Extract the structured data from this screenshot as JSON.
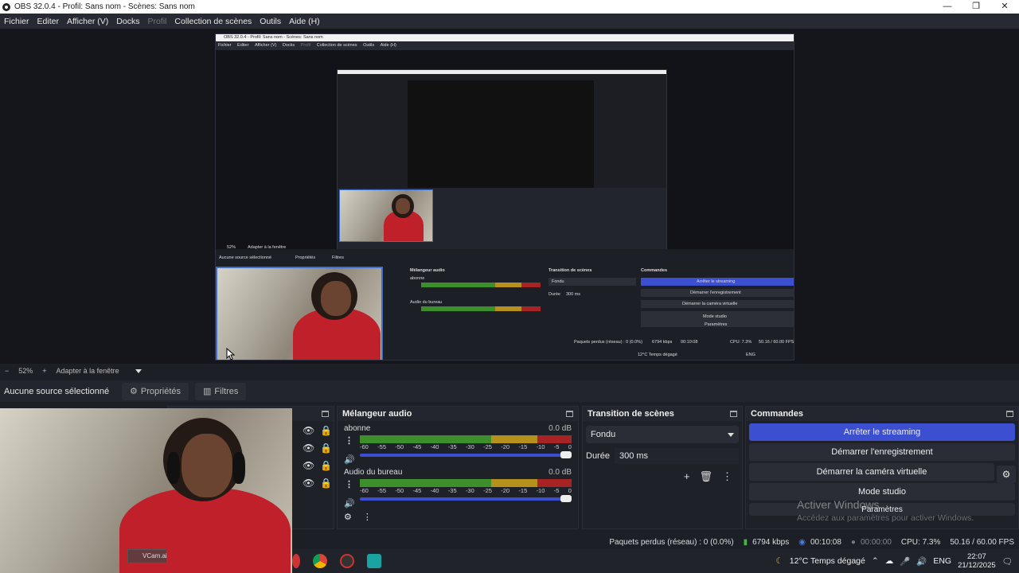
{
  "window": {
    "title": "OBS 32.0.4 - Profil: Sans nom - Scènes: Sans nom",
    "minimize": "—",
    "maximize": "❐",
    "close": "✕"
  },
  "menu": {
    "fichier": "Fichier",
    "editer": "Editer",
    "afficher": "Afficher (V)",
    "docks": "Docks",
    "profil": "Profil",
    "collection": "Collection de scènes",
    "outils": "Outils",
    "aide": "Aide (H)"
  },
  "zoom": {
    "minus": "−",
    "value": "52%",
    "plus": "+",
    "fit": "Adapter à la fenêtre"
  },
  "sourcebar": {
    "label": "Aucune source sélectionné",
    "properties": "Propriétés",
    "filters": "Filtres"
  },
  "webcam": {
    "overlay_text": "VCam.ai"
  },
  "mixer": {
    "title": "Mélangeur audio",
    "tracks": [
      {
        "name": "abonne",
        "db": "0.0 dB"
      },
      {
        "name": "Audio du bureau",
        "db": "0.0 dB"
      }
    ],
    "scale": [
      "-60",
      "-55",
      "-50",
      "-45",
      "-40",
      "-35",
      "-30",
      "-25",
      "-20",
      "-15",
      "-10",
      "-5",
      "0"
    ]
  },
  "transition": {
    "title": "Transition de scènes",
    "selected": "Fondu",
    "duration_label": "Durée",
    "duration_value": "300 ms"
  },
  "commands": {
    "title": "Commandes",
    "stop_stream": "Arrêter le streaming",
    "start_record": "Démarrer l'enregistrement",
    "virtual_cam": "Démarrer la caméra virtuelle",
    "studio_mode": "Mode studio",
    "settings": "Paramètres"
  },
  "watermark": {
    "line1": "Activer Windows",
    "line2": "Accédez aux paramètres pour activer Windows."
  },
  "status": {
    "dropped": "Paquets perdus (réseau) : 0 (0.0%)",
    "bitrate": "6794 kbps",
    "stream_time": "00:10:08",
    "rec_time": "00:00:00",
    "cpu": "CPU: 7.3%",
    "fps": "50.16 / 60.00 FPS"
  },
  "taskbar": {
    "weather": "12°C  Temps dégagé",
    "lang": "ENG",
    "time": "22:07",
    "date": "21/12/2025"
  },
  "nested": {
    "title": "OBS 32.0.4 - Profil: Sans nom - Scènes: Sans nom",
    "menu": [
      "Fichier",
      "Editer",
      "Afficher (V)",
      "Docks",
      "Profil",
      "Collection de scènes",
      "Outils",
      "Aide (H)"
    ],
    "zoom": "52%",
    "fit": "Adapter à la fenêtre",
    "no_source": "Aucune source sélectionné",
    "props": "Propriétés",
    "filters": "Filtres",
    "mixer": "Mélangeur audio",
    "track1": "abonne",
    "track2": "Audio du bureau",
    "transition": "Transition de scènes",
    "fondu": "Fondu",
    "duree": "Durée",
    "duree_val": "300 ms",
    "commandes": "Commandes",
    "stop": "Arrêter le streaming",
    "record": "Démarrer l'enregistrement",
    "vcam": "Démarrer la caméra virtuelle",
    "studio": "Mode studio",
    "params": "Paramètres",
    "dropped": "Paquets perdus (réseau) : 0 (0.0%)",
    "bitrate": "6794 kbps",
    "time": "00:10:08",
    "cpu": "CPU: 7.3%",
    "fps": "50.16 / 60.00 FPS",
    "weather": "12°C  Temps dégagé",
    "lang": "ENG"
  }
}
